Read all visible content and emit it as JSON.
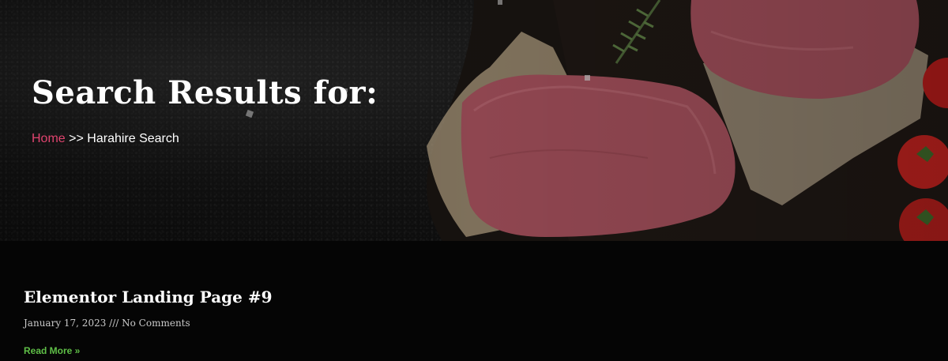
{
  "hero": {
    "title": "Search Results for:",
    "breadcrumb": {
      "home_label": "Home",
      "separator": ">>",
      "current": "Harahire Search"
    },
    "background_image": "tuna-steak-on-board-image"
  },
  "results": [
    {
      "title": "Elementor Landing Page #9",
      "date": "January 17, 2023",
      "meta_separator": "///",
      "comments": "No Comments",
      "read_more_label": "Read More »"
    }
  ],
  "colors": {
    "background": "#050505",
    "breadcrumb_link": "#e0446f",
    "read_more": "#5fbf47",
    "text": "#ffffff",
    "meta_text": "#c9c9c9"
  }
}
